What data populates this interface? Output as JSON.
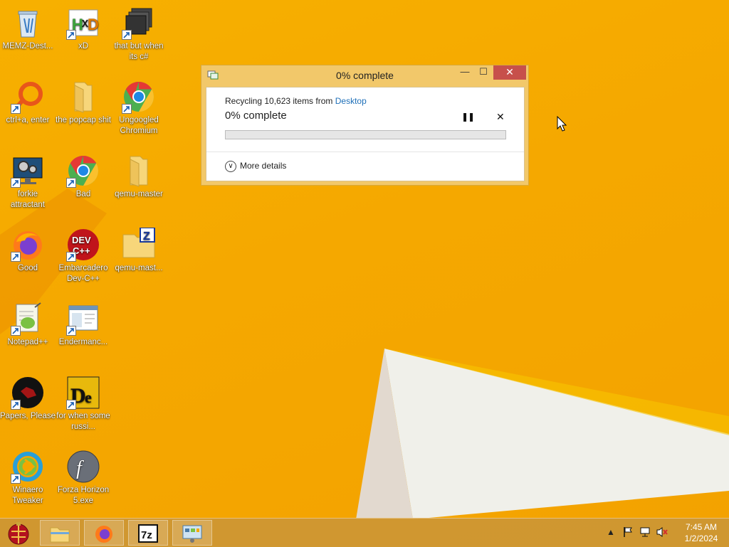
{
  "desktop": {
    "icons": [
      {
        "label": "MEMZ-Dest...",
        "icon": "recycle-bin-icon"
      },
      {
        "label": "xD",
        "icon": "hxd-icon"
      },
      {
        "label": "that but when its c#",
        "icon": "terminal-stack-icon"
      },
      {
        "label": "ctrl+a, enter",
        "icon": "ring-icon"
      },
      {
        "label": "the popcap shit",
        "icon": "folder-icon"
      },
      {
        "label": "Ungoogled Chromium",
        "icon": "chromium-icon"
      },
      {
        "label": "forkie attractant",
        "icon": "settings-monitor-icon"
      },
      {
        "label": "Bad",
        "icon": "chrome-icon"
      },
      {
        "label": "qemu-master",
        "icon": "folder-icon"
      },
      {
        "label": "Good",
        "icon": "firefox-icon"
      },
      {
        "label": "Embarcadero Dev-C++",
        "icon": "devcpp-icon"
      },
      {
        "label": "qemu-mast...",
        "icon": "zip-folder-icon"
      },
      {
        "label": "Notepad++",
        "icon": "notepadpp-icon"
      },
      {
        "label": "Endermanc...",
        "icon": "window-app-icon"
      },
      {
        "label": "Papers, Please",
        "icon": "papers-please-icon"
      },
      {
        "label": "for when some russi...",
        "icon": "detect-it-easy-icon"
      },
      {
        "label": "Winaero Tweaker",
        "icon": "winaero-icon"
      },
      {
        "label": "Forza Horizon 5.exe",
        "icon": "flash-icon"
      }
    ]
  },
  "dialog": {
    "title": "0% complete",
    "status_prefix": "Recycling 10,623 items from ",
    "status_link": "Desktop",
    "progress_text": "0% complete",
    "progress_fraction": 0.0,
    "more_details": "More details",
    "minimize": "—",
    "maximize": "☐",
    "close": "✕",
    "pause": "❚❚",
    "cancel": "✕"
  },
  "taskbar": {
    "apps": [
      "file-explorer-icon",
      "firefox-icon",
      "7zip-icon",
      "control-panel-icon"
    ],
    "clock_time": "7:45 AM",
    "clock_date": "1/2/2024",
    "tray_icons": [
      "chevron-up-icon",
      "flag-icon",
      "network-icon",
      "volume-muted-icon"
    ]
  },
  "colors": {
    "wallpaper": "#f5a800",
    "close_red": "#c7504b",
    "link_blue": "#1e6fb8"
  }
}
